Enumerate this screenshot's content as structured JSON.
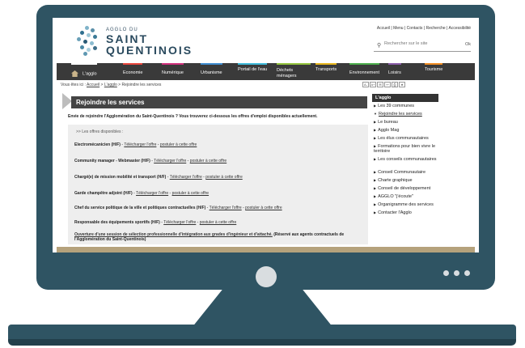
{
  "site": {
    "logo_small": "AGGLO DU",
    "logo_line1": "SAINT",
    "logo_line2": "QUENTINOIS",
    "top_links": [
      "Accueil",
      "Menu",
      "Contacts",
      "Recherche",
      "Accessibilité"
    ],
    "search_placeholder": "Rechercher sur le site",
    "search_ok": "Ok"
  },
  "nav": {
    "items": [
      {
        "label": "L'agglo",
        "color": "#ffffff"
      },
      {
        "label": "Economie",
        "color": "#e8463c"
      },
      {
        "label": "Numérique",
        "color": "#d0307c"
      },
      {
        "label": "Urbanisme",
        "color": "#3f8ccf"
      },
      {
        "label": "Portail de l'eau",
        "color": "#3fbad9"
      },
      {
        "label": "Déchets ménagers",
        "color": "#93c33c"
      },
      {
        "label": "Transports",
        "color": "#e6b51d"
      },
      {
        "label": "Environnement",
        "color": "#4cae4c"
      },
      {
        "label": "Loisirs",
        "color": "#8a5ca8"
      },
      {
        "label": "Tourisme",
        "color": "#f08c22"
      }
    ]
  },
  "breadcrumb": {
    "prefix": "Vous êtes ici :",
    "items": [
      "Accueil",
      "L'agglo",
      "Rejoindre les services"
    ]
  },
  "tools": [
    "A-",
    "A+",
    "✉",
    "↩",
    "⎙",
    "★"
  ],
  "page": {
    "title": "Rejoindre les services",
    "intro": "Envie de rejoindre l'Agglomération du Saint-Quentinois ? Vous trouverez ci-dessous les offres d'emploi disponibles actuellement.",
    "offers_header": ">> Les offres disponibles :",
    "download_label": "Télécharger l'offre",
    "apply_label": "postuler à cette offre",
    "offers": [
      {
        "title": "Electromécanicien (H/F)"
      },
      {
        "title": "Community manager - Webmaster (H/F)"
      },
      {
        "title": "Chargé(e) de mission mobilité et transport (H/F)"
      },
      {
        "title": "Garde champêtre adjoint (H/F)"
      },
      {
        "title": "Chef du service politique de la ville et politiques contractuelles (H/F)"
      },
      {
        "title": "Responsable des équipements sportifs (H/F)"
      }
    ],
    "last_offer_link": "Ouverture d'une session de sélection professionnelle d'intégration aux grades d'ingénieur et d'attaché.",
    "last_offer_note": "(Réservé aux agents contractuels de l'Agglomération du Saint-Quentinois)"
  },
  "sidebar": {
    "title": "L'agglo",
    "items": [
      "Les 39 communes",
      "Rejoindre les services",
      "Le bureau",
      "Agglo Mag",
      "Les élus communautaires",
      "Formations pour bien vivre le territoire",
      "Les conseils communautaires",
      "Conseil Communautaire",
      "Charte graphique",
      "Conseil de développement",
      "AGGLO \"j'écoute\"",
      "Organigramme des services",
      "Contacter l'Agglo"
    ]
  },
  "colors": {
    "monitor": "#2f5463",
    "nav_bg": "#3a3a3a",
    "title_bar": "#444444"
  }
}
